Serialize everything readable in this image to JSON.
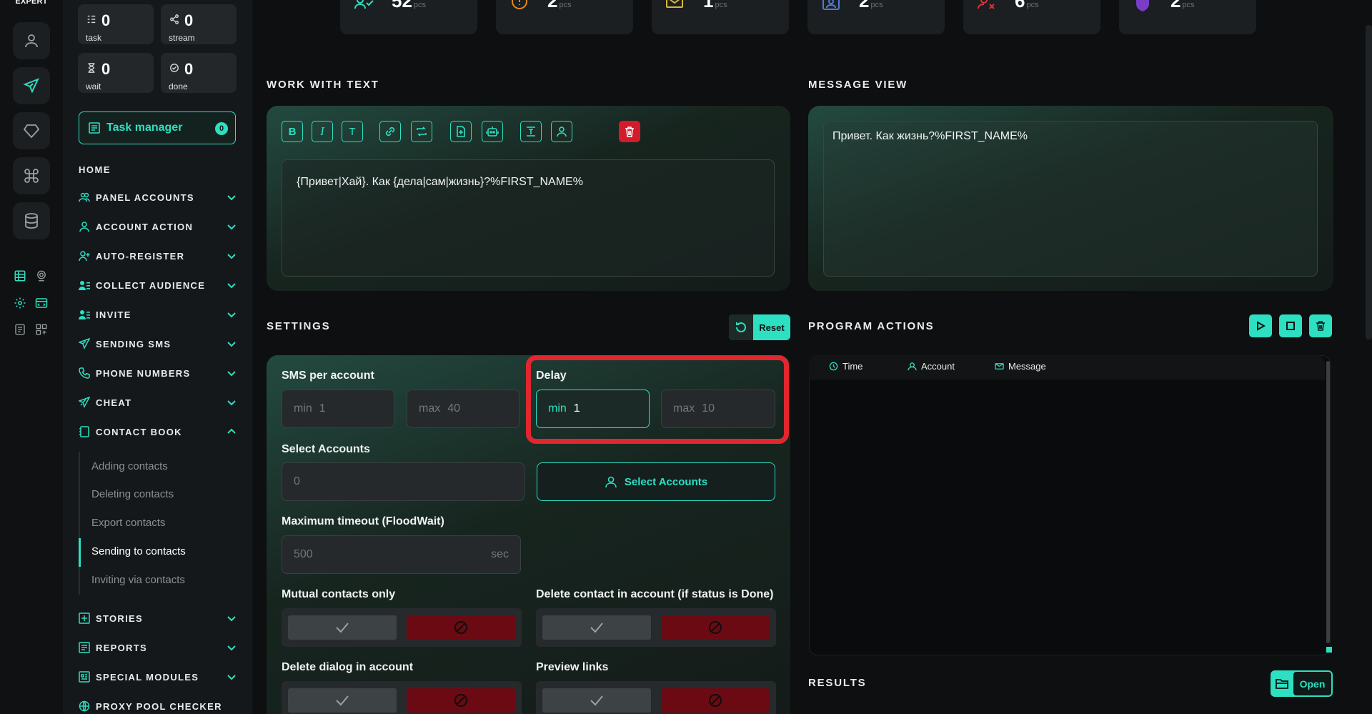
{
  "brand": "EXPERT",
  "colors": {
    "accent": "#2de0c2",
    "danger": "#d31b2b",
    "highlight": "#e0272f"
  },
  "rail": {
    "buttons": [
      "user-icon",
      "send-icon",
      "diamond-icon",
      "command-icon",
      "database-icon"
    ],
    "mini": [
      "table-icon",
      "webcam-icon",
      "gear-icon",
      "browser-icon",
      "list-icon",
      "grid-icon"
    ]
  },
  "stats": {
    "task": {
      "value": "0",
      "label": "task"
    },
    "stream": {
      "value": "0",
      "label": "stream"
    },
    "wait": {
      "value": "0",
      "label": "wait"
    },
    "done": {
      "value": "0",
      "label": "done"
    }
  },
  "task_manager": {
    "label": "Task manager",
    "badge": "0"
  },
  "nav": {
    "home": "HOME",
    "items": [
      "PANEL ACCOUNTS",
      "ACCOUNT ACTION",
      "AUTO-REGISTER",
      "COLLECT AUDIENCE",
      "INVITE",
      "SENDING SMS",
      "PHONE NUMBERS",
      "CHEAT",
      "CONTACT BOOK",
      "STORIES",
      "REPORTS",
      "SPECIAL MODULES",
      "PROXY POOL CHECKER"
    ],
    "contact_book_sub": [
      "Adding contacts",
      "Deleting contacts",
      "Export contacts",
      "Sending to contacts",
      "Inviting via contacts"
    ]
  },
  "top_cards": [
    {
      "value": "52",
      "unit": "pcs",
      "icon": "user-check-icon"
    },
    {
      "value": "2",
      "unit": "pcs",
      "icon": "warning-icon"
    },
    {
      "value": "1",
      "unit": "pcs",
      "icon": "envelope-warning-icon"
    },
    {
      "value": "2",
      "unit": "pcs",
      "icon": "id-card-icon"
    },
    {
      "value": "6",
      "unit": "pcs",
      "icon": "user-x-icon"
    },
    {
      "value": "2",
      "unit": "pcs",
      "icon": "shield-icon"
    }
  ],
  "work_with_text": {
    "title": "WORK WITH TEXT",
    "tools": [
      "B",
      "I",
      "T",
      "link-icon",
      "repeat-icon",
      "file-icon",
      "bot-icon",
      "text-block-icon",
      "person-icon",
      "trash-icon"
    ],
    "text": "{Привет|Хай}. Как {дела|сам|жизнь}?%FIRST_NAME%"
  },
  "message_view": {
    "title": "MESSAGE VIEW",
    "text": "Привет. Как жизнь?%FIRST_NAME%"
  },
  "settings": {
    "title": "SETTINGS",
    "reset_label": "Reset",
    "sms_per_account": {
      "label": "SMS per account",
      "min_placeholder": "min",
      "min_value": "1",
      "max_placeholder": "max",
      "max_value": "40"
    },
    "delay": {
      "label": "Delay",
      "min_placeholder": "min",
      "min_value": "1",
      "max_placeholder": "max",
      "max_value": "10"
    },
    "select_accounts": {
      "label": "Select Accounts",
      "value": "0",
      "button": "Select Accounts"
    },
    "max_timeout": {
      "label": "Maximum timeout (FloodWait)",
      "value": "500",
      "unit": "sec"
    },
    "mutual_contacts": {
      "label": "Mutual contacts only"
    },
    "delete_contact": {
      "label": "Delete contact in account (if status is Done)"
    },
    "delete_dialog": {
      "label": "Delete dialog in account"
    },
    "preview_links": {
      "label": "Preview links"
    }
  },
  "program_actions": {
    "title": "PROGRAM ACTIONS",
    "columns": [
      "Time",
      "Account",
      "Message"
    ]
  },
  "results": {
    "title": "RESULTS",
    "open_label": "Open"
  }
}
